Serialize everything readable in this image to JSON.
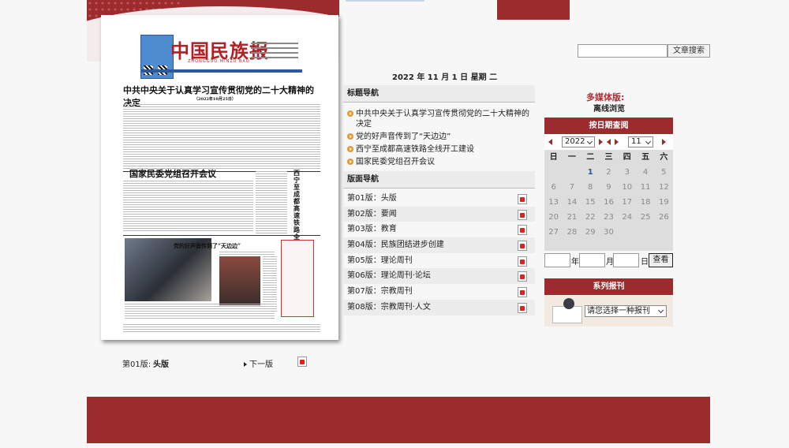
{
  "colors": {
    "brand_red": "#9c2b2e",
    "accent_orange": "#e49b2e",
    "link_blue": "#2a5a9c"
  },
  "search": {
    "button_label": "文章搜索",
    "placeholder": ""
  },
  "paper": {
    "logo": "中国民族报",
    "logo_sub": "ZHONGGUO MINZU BAO",
    "headline": "中共中央关于认真学习宣传贯彻党的二十大精神的决定",
    "headline_date": "（2022年10月25日）",
    "subhead": "国家民委党组召开会议",
    "photo_caption": "党的好声音传到了“天边边”",
    "vertical_head": "西宁至成都高速铁路全线开工建设"
  },
  "page_footer": {
    "label": "第01版:",
    "name": "头版",
    "next": "下一版",
    "pdf_icon": "pdf-icon"
  },
  "date_line": "2022 年 11 月 1 日   星期 二",
  "title_nav": {
    "heading": "标题导航",
    "items": [
      "中共中央关于认真学习宣传贯彻党的二十大精神的决定",
      "党的好声音传到了“天边边”",
      "西宁至成都高速铁路全线开工建设",
      "国家民委党组召开会议"
    ]
  },
  "page_nav": {
    "heading": "版面导航",
    "items": [
      "第01版：头版",
      "第02版：要闻",
      "第03版：教育",
      "第04版：民族团结进步创建",
      "第05版：理论周刊",
      "第06版：理论周刊·论坛",
      "第07版：宗教周刊",
      "第08版：宗教周刊·人文"
    ]
  },
  "media": {
    "title": "多媒体版:",
    "offline": "离线浏览"
  },
  "calendar": {
    "heading": "按日期查阅",
    "year": "2022",
    "month": "11",
    "weekdays": [
      "日",
      "一",
      "二",
      "三",
      "四",
      "五",
      "六"
    ],
    "days": [
      "1",
      "2",
      "3",
      "4",
      "5",
      "6",
      "7",
      "8",
      "9",
      "10",
      "11",
      "12",
      "13",
      "14",
      "15",
      "16",
      "17",
      "18",
      "19",
      "20",
      "21",
      "22",
      "23",
      "24",
      "25",
      "26",
      "27",
      "28",
      "29",
      "30"
    ],
    "first_weekday_index": 2,
    "active_day": "1",
    "year_label": "年",
    "month_label": "月",
    "day_label": "日",
    "query_button": "查看"
  },
  "series": {
    "heading": "系列报刊",
    "select_placeholder": "请您选择一种报刊"
  }
}
